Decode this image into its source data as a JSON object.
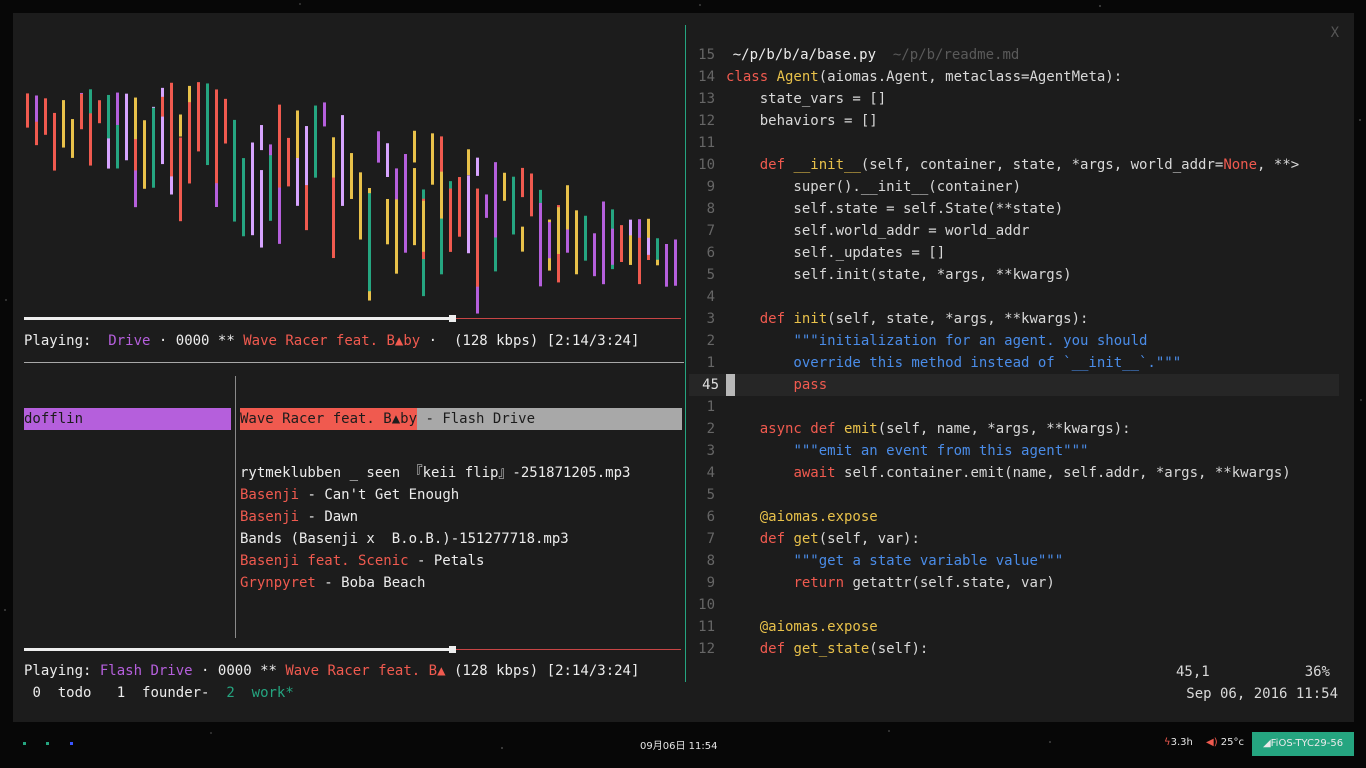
{
  "colors": {
    "red": "#f05a4f",
    "purple": "#b55fdc",
    "lilac": "#d7a4ff",
    "yellow": "#e8c14a",
    "green": "#25a580",
    "background": "#1c1c1c"
  },
  "visualizer": {
    "icon": "audio-spectrum-visualizer",
    "palette": [
      "#f05a4f",
      "#e8c14a",
      "#25a580",
      "#b55fdc",
      "#d7a4ff"
    ]
  },
  "player_top": {
    "progress_fraction": 0.651,
    "label": "Playing:",
    "album": "Drive",
    "sep1": "·",
    "count": "0000",
    "stars": "**",
    "artist": "Wave Racer feat. B▲by",
    "sep2": "·",
    "bitrate": "(128 kbps)",
    "time": "[2:14/3:24]"
  },
  "library": {
    "selected_artist": "dofflin",
    "selected_track": {
      "artist": "Wave Racer feat. B▲by",
      "sep": " - ",
      "title": "Flash Drive"
    },
    "tracks": [
      {
        "artist": "",
        "sep": "",
        "title": "rytmeklubben _ seen 『keii flip』-251871205.mp3"
      },
      {
        "artist": "Basenji",
        "sep": " - ",
        "title": "Can't Get Enough"
      },
      {
        "artist": "Basenji",
        "sep": " - ",
        "title": "Dawn"
      },
      {
        "artist": "",
        "sep": "",
        "title": "Bands (Basenji x  B.o.B.)-151277718.mp3"
      },
      {
        "artist": "Basenji feat. Scenic",
        "sep": " - ",
        "title": "Petals"
      },
      {
        "artist": "Grynpyret",
        "sep": " - ",
        "title": "Boba Beach"
      }
    ]
  },
  "player_bottom": {
    "progress_fraction": 0.651,
    "label": "Playing:",
    "album": "Flash Drive",
    "sep1": "·",
    "count": "0000",
    "stars": "**",
    "artist": "Wave Racer feat. B▲",
    "bitrate": "(128 kbps)",
    "time": "[2:14/3:24]"
  },
  "tags": [
    {
      "num": "0",
      "name": "todo"
    },
    {
      "num": "1",
      "name": "founder-"
    },
    {
      "num": "2",
      "name": "work*"
    }
  ],
  "editor": {
    "tab_active": "~/p/b/b/a/base.py",
    "tab_inactive": "~/p/b/readme.md",
    "close": "X",
    "cursor_pos": "45,1",
    "percent": "36%",
    "datetime": "Sep 06, 2016 11:54",
    "lines": [
      {
        "n": "15",
        "parts": []
      },
      {
        "n": "14",
        "parts": [
          [
            "kw",
            "class "
          ],
          [
            "fn",
            "Agent"
          ],
          [
            "txt",
            "(aiomas.Agent, metaclass=AgentMeta):"
          ]
        ]
      },
      {
        "n": "13",
        "parts": [
          [
            "txt",
            "    state_vars = []"
          ]
        ]
      },
      {
        "n": "12",
        "parts": [
          [
            "txt",
            "    behaviors = []"
          ]
        ]
      },
      {
        "n": "11",
        "parts": []
      },
      {
        "n": "10",
        "parts": [
          [
            "txt",
            "    "
          ],
          [
            "kw",
            "def "
          ],
          [
            "fn",
            "__init__"
          ],
          [
            "txt",
            "(self, container, state, *args, world_addr="
          ],
          [
            "nonec",
            "None"
          ],
          [
            "txt",
            ", **>"
          ]
        ]
      },
      {
        "n": "9",
        "parts": [
          [
            "txt",
            "        super().__init__(container)"
          ]
        ]
      },
      {
        "n": "8",
        "parts": [
          [
            "txt",
            "        self.state = self.State(**state)"
          ]
        ]
      },
      {
        "n": "7",
        "parts": [
          [
            "txt",
            "        self.world_addr = world_addr"
          ]
        ]
      },
      {
        "n": "6",
        "parts": [
          [
            "txt",
            "        self._updates = []"
          ]
        ]
      },
      {
        "n": "5",
        "parts": [
          [
            "txt",
            "        self.init(state, *args, **kwargs)"
          ]
        ]
      },
      {
        "n": "4",
        "parts": []
      },
      {
        "n": "3",
        "parts": [
          [
            "txt",
            "    "
          ],
          [
            "kw",
            "def "
          ],
          [
            "fn",
            "init"
          ],
          [
            "txt",
            "(self, state, *args, **kwargs):"
          ]
        ]
      },
      {
        "n": "2",
        "parts": [
          [
            "txt",
            "        "
          ],
          [
            "doc",
            "\"\"\"initialization for an agent. you should"
          ]
        ]
      },
      {
        "n": "1",
        "parts": [
          [
            "doc",
            "        override this method instead of `__init__`.\"\"\""
          ]
        ]
      },
      {
        "n": "45",
        "current": true,
        "parts": [
          [
            "txt",
            "        "
          ],
          [
            "kw",
            "pass"
          ]
        ]
      },
      {
        "n": "1",
        "parts": []
      },
      {
        "n": "2",
        "parts": [
          [
            "txt",
            "    "
          ],
          [
            "kw",
            "async def "
          ],
          [
            "fn",
            "emit"
          ],
          [
            "txt",
            "(self, name, *args, **kwargs):"
          ]
        ]
      },
      {
        "n": "3",
        "parts": [
          [
            "txt",
            "        "
          ],
          [
            "doc",
            "\"\"\"emit an event from this agent\"\"\""
          ]
        ]
      },
      {
        "n": "4",
        "parts": [
          [
            "txt",
            "        "
          ],
          [
            "kw",
            "await "
          ],
          [
            "txt",
            "self.container.emit(name, self.addr, *args, **kwargs)"
          ]
        ]
      },
      {
        "n": "5",
        "parts": []
      },
      {
        "n": "6",
        "parts": [
          [
            "txt",
            "    "
          ],
          [
            "fn",
            "@aiomas.expose"
          ]
        ]
      },
      {
        "n": "7",
        "parts": [
          [
            "txt",
            "    "
          ],
          [
            "kw",
            "def "
          ],
          [
            "fn",
            "get"
          ],
          [
            "txt",
            "(self, var):"
          ]
        ]
      },
      {
        "n": "8",
        "parts": [
          [
            "txt",
            "        "
          ],
          [
            "doc",
            "\"\"\"get a state variable value\"\"\""
          ]
        ]
      },
      {
        "n": "9",
        "parts": [
          [
            "txt",
            "        "
          ],
          [
            "kw",
            "return "
          ],
          [
            "txt",
            "getattr(self.state, var)"
          ]
        ]
      },
      {
        "n": "10",
        "parts": []
      },
      {
        "n": "11",
        "parts": [
          [
            "txt",
            "    "
          ],
          [
            "fn",
            "@aiomas.expose"
          ]
        ]
      },
      {
        "n": "12",
        "parts": [
          [
            "txt",
            "    "
          ],
          [
            "kw",
            "def "
          ],
          [
            "fn",
            "get_state"
          ],
          [
            "txt",
            "(self):"
          ]
        ]
      }
    ]
  },
  "taskbar": {
    "workspace_dots": [
      "#25a580",
      "#25a580",
      "#3a55ff"
    ],
    "time": "09月06日 11:54",
    "battery_icon": "bolt-icon",
    "battery": "3.3h",
    "volume_icon": "speaker-icon",
    "temp": "25°c",
    "wifi_icon": "wifi-icon",
    "wifi": "FiOS-TYC29-56"
  }
}
